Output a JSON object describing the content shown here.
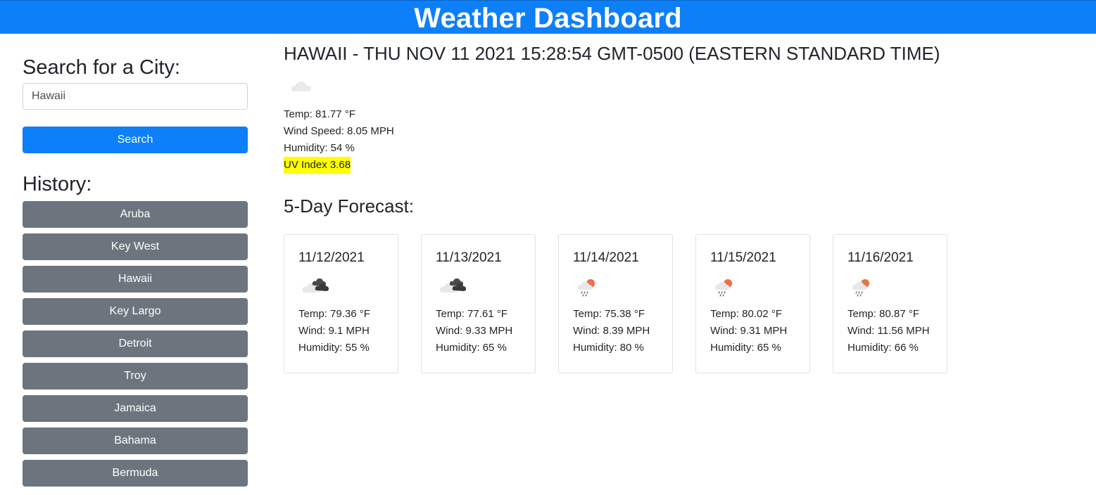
{
  "header": {
    "title": "Weather Dashboard"
  },
  "sidebar": {
    "search_heading": "Search for a City:",
    "search_value": "Hawaii",
    "search_button": "Search",
    "history_heading": "History:",
    "history": [
      "Aruba",
      "Key West",
      "Hawaii",
      "Key Largo",
      "Detroit",
      "Troy",
      "Jamaica",
      "Bahama",
      "Bermuda"
    ]
  },
  "current": {
    "title": "Hawaii - Thu Nov 11 2021 15:28:54 GMT-0500 (Eastern Standard Time)",
    "icon": "cloud-icon",
    "temp": "Temp: 81.77 °F",
    "wind": "Wind Speed: 8.05 MPH",
    "humidity": "Humidity: 54 %",
    "uv": "UV Index 3.68",
    "uv_color": "#ffff00"
  },
  "forecast": {
    "heading": "5-Day Forecast:",
    "days": [
      {
        "date": "11/12/2021",
        "icon": "broken-clouds-icon",
        "temp": "Temp: 79.36 °F",
        "wind": "Wind: 9.1 MPH",
        "humidity": "Humidity: 55 %"
      },
      {
        "date": "11/13/2021",
        "icon": "broken-clouds-icon",
        "temp": "Temp: 77.61 °F",
        "wind": "Wind: 9.33 MPH",
        "humidity": "Humidity: 65 %"
      },
      {
        "date": "11/14/2021",
        "icon": "rain-sun-icon",
        "temp": "Temp: 75.38 °F",
        "wind": "Wind: 8.39 MPH",
        "humidity": "Humidity: 80 %"
      },
      {
        "date": "11/15/2021",
        "icon": "rain-sun-icon",
        "temp": "Temp: 80.02 °F",
        "wind": "Wind: 9.31 MPH",
        "humidity": "Humidity: 65 %"
      },
      {
        "date": "11/16/2021",
        "icon": "rain-sun-icon",
        "temp": "Temp: 80.87 °F",
        "wind": "Wind: 11.56 MPH",
        "humidity": "Humidity: 66 %"
      }
    ]
  },
  "colors": {
    "primary": "#0d7ff9",
    "secondary": "#6c757d",
    "highlight": "#ffff00"
  }
}
